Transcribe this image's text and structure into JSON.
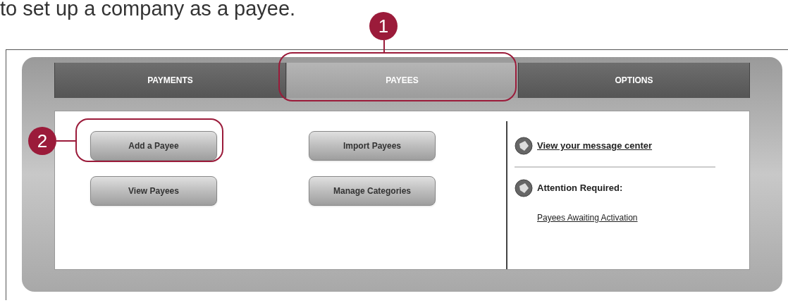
{
  "intro_text": "to set up a company as a payee.",
  "tabs": [
    {
      "label": "PAYMENTS",
      "selected": false
    },
    {
      "label": "PAYEES",
      "selected": true
    },
    {
      "label": "OPTIONS",
      "selected": false
    }
  ],
  "buttons": [
    [
      "Add a Payee",
      "View Payees"
    ],
    [
      "Import Payees",
      "Manage Categories"
    ]
  ],
  "side_panel": {
    "message_link": "View your message center",
    "attention_label": "Attention Required:",
    "attention_link": "Payees Awaiting Activation"
  },
  "callouts": [
    {
      "number": "1"
    },
    {
      "number": "2"
    }
  ]
}
